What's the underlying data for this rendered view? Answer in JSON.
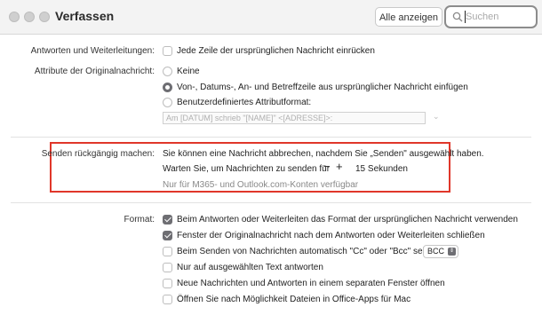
{
  "window": {
    "title": "Verfassen",
    "show_all": "Alle anzeigen",
    "search_placeholder": "Suchen"
  },
  "replies": {
    "label": "Antworten und Weiterleitungen:",
    "indent": {
      "label": "Jede Zeile der ursprünglichen Nachricht einrücken",
      "checked": false
    }
  },
  "attributes": {
    "label": "Attribute der Originalnachricht:",
    "options": [
      {
        "label": "Keine",
        "selected": false
      },
      {
        "label": "Von-, Datums-, An- und Betreffzeile aus ursprünglicher Nachricht einfügen",
        "selected": true
      },
      {
        "label": "Benutzerdefiniertes Attributformat:",
        "selected": false
      }
    ],
    "custom_format": "Am [DATUM] schrieb \"[NAME]\" <[ADRESSE]>:"
  },
  "undo_send": {
    "label": "Senden rückgängig machen:",
    "description": "Sie können eine Nachricht abbrechen, nachdem Sie „Senden\" ausgewählt haben.",
    "wait_label": "Warten Sie, um Nachrichten zu senden für",
    "minus": "−",
    "plus": "+",
    "value": "15 Sekunden",
    "note": "Nur für M365- und Outlook.com-Konten verfügbar"
  },
  "format": {
    "label": "Format:",
    "options": [
      {
        "label": "Beim Antworten oder Weiterleiten das Format der ursprünglichen Nachricht verwenden",
        "checked": true
      },
      {
        "label": "Fenster der Originalnachricht nach dem Antworten oder Weiterleiten schließen",
        "checked": true
      },
      {
        "label": "Beim Senden von Nachrichten automatisch \"Cc\" oder \"Bcc\" selbst",
        "checked": false
      },
      {
        "label": "Nur auf ausgewählten Text antworten",
        "checked": false
      },
      {
        "label": "Neue Nachrichten und Antworten in einem separaten Fenster öffnen",
        "checked": false
      },
      {
        "label": "Öffnen Sie nach Möglichkeit Dateien in Office-Apps für Mac",
        "checked": false
      }
    ],
    "cc_select_value": "BCC"
  }
}
